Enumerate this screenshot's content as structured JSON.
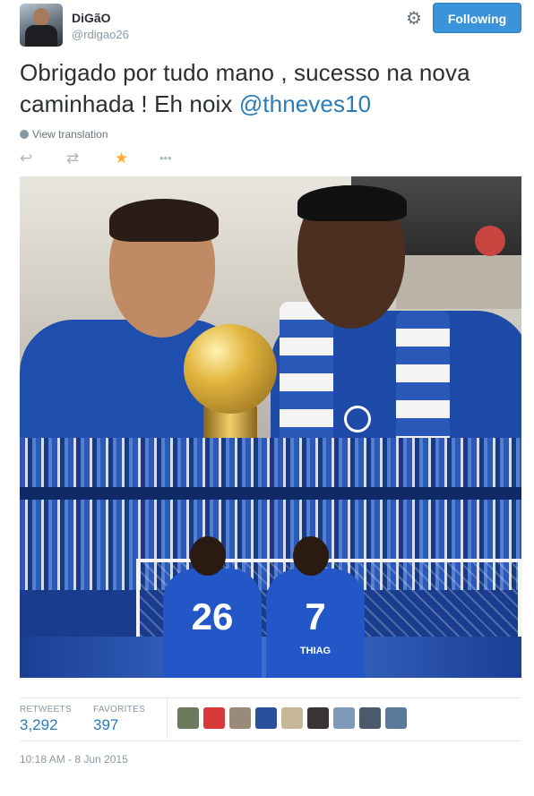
{
  "user": {
    "name": "DiGãO",
    "handle": "@rdigao26"
  },
  "header": {
    "follow_label": "Following"
  },
  "tweet": {
    "text": "Obrigado por tudo mano , sucesso na nova caminhada ! Eh noix ",
    "mention": "@thneves10",
    "translate_label": "View translation",
    "timestamp": "10:18 AM - 8 Jun 2015"
  },
  "actions": {
    "reply_icon": "↩",
    "retweet_icon": "⇄",
    "favorite_icon": "★",
    "more_icon": "•••"
  },
  "photo": {
    "player1_number": "26",
    "player2_number": "7",
    "player2_name": "THIAG"
  },
  "stats": {
    "retweets_label": "RETWEETS",
    "retweets_value": "3,292",
    "favorites_label": "FAVORITES",
    "favorites_value": "397"
  },
  "colors": {
    "accent": "#2b7bb9",
    "follow_button": "#3b94d9",
    "favorite_star": "#ffac33",
    "muted": "#8899a6"
  },
  "favoriters": [
    {
      "name": "favoriter-avatar-1",
      "color": "#6b7a5a"
    },
    {
      "name": "favoriter-avatar-2",
      "color": "#d83a3a"
    },
    {
      "name": "favoriter-avatar-3",
      "color": "#9a8a7a"
    },
    {
      "name": "favoriter-avatar-4",
      "color": "#2a4f9a"
    },
    {
      "name": "favoriter-avatar-5",
      "color": "#c8b89a"
    },
    {
      "name": "favoriter-avatar-6",
      "color": "#3a3434"
    },
    {
      "name": "favoriter-avatar-7",
      "color": "#7e9ab8"
    },
    {
      "name": "favoriter-avatar-8",
      "color": "#4a5a6a"
    },
    {
      "name": "favoriter-avatar-9",
      "color": "#5a7a9a"
    }
  ]
}
